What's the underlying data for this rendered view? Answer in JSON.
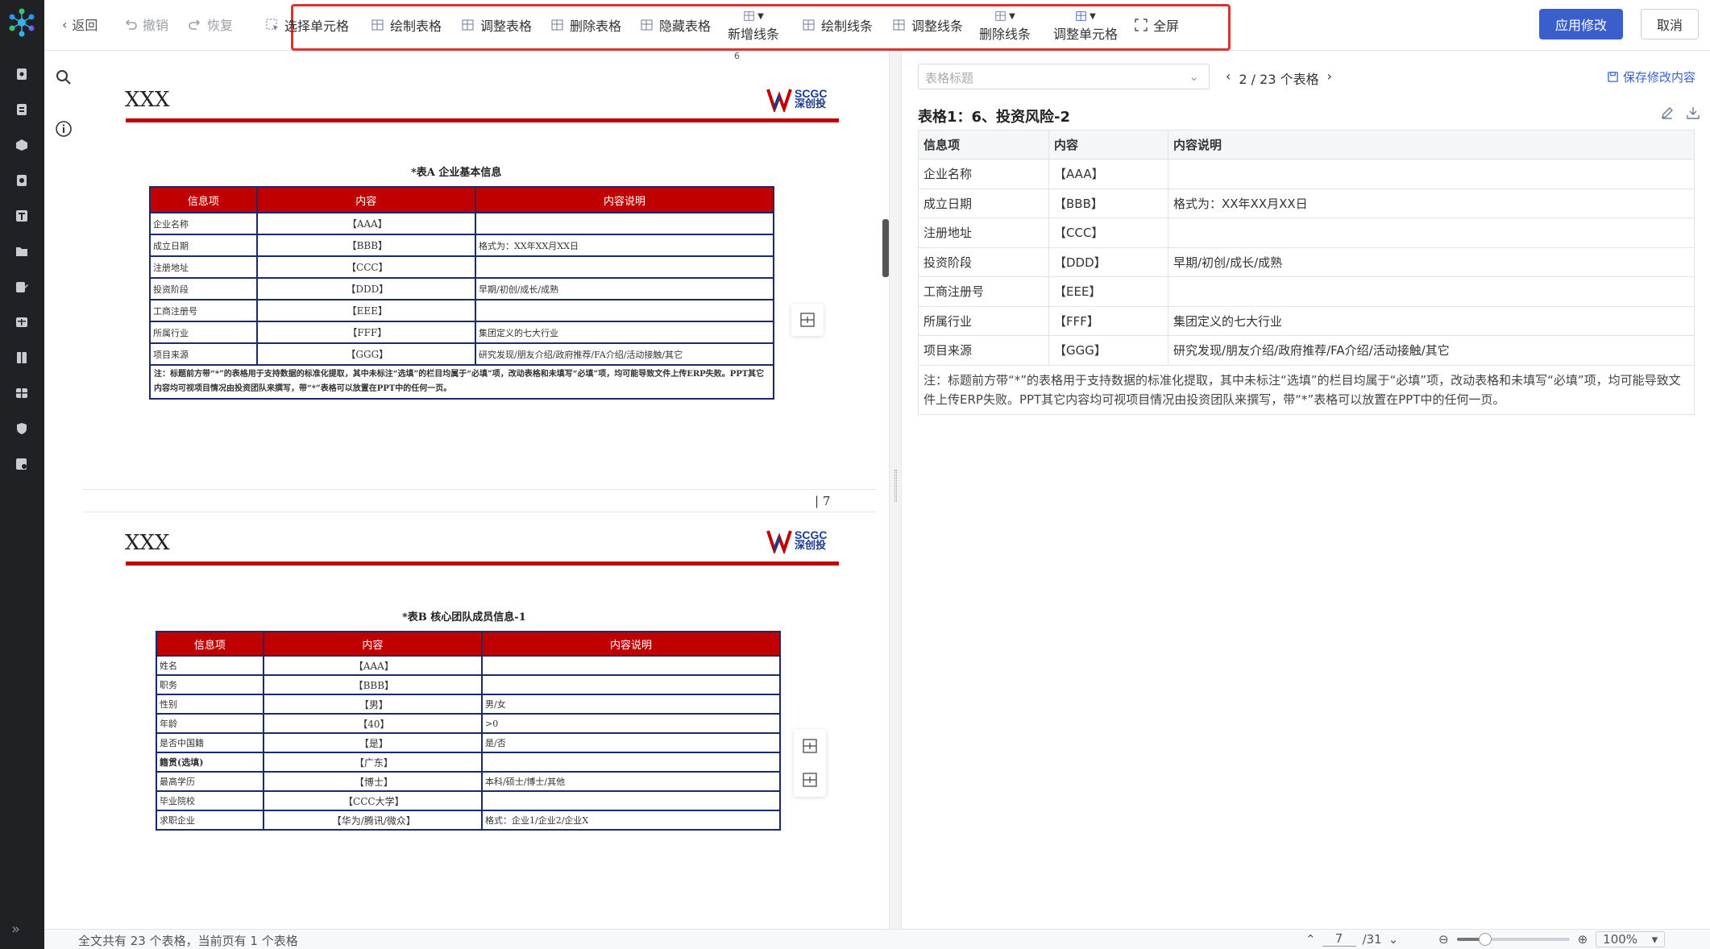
{
  "topbar": {
    "back": "返回",
    "undo": "撤销",
    "redo": "恢复",
    "tools": {
      "select_cell": "选择单元格",
      "draw_table": "绘制表格",
      "adjust_table": "调整表格",
      "delete_table": "删除表格",
      "hide_table": "隐藏表格",
      "add_line": "新增线条",
      "draw_line": "绘制线条",
      "adjust_line": "调整线条",
      "delete_line": "删除线条",
      "adjust_cell": "调整单元格",
      "fullscreen": "全屏"
    },
    "apply": "应用修改",
    "cancel": "取消",
    "accent_color": "#3a5fcd",
    "highlight_color": "#e03131"
  },
  "doc": {
    "page_label_top": "6",
    "slide1": {
      "title": "XXX",
      "brand_en": "SCGC",
      "brand_cn": "深创投",
      "table_caption": "*表A 企业基本信息",
      "headers": [
        "信息项",
        "内容",
        "内容说明"
      ],
      "rows": [
        [
          "企业名称",
          "【AAA】",
          ""
        ],
        [
          "成立日期",
          "【BBB】",
          "格式为：XX年XX月XX日"
        ],
        [
          "注册地址",
          "【CCC】",
          ""
        ],
        [
          "投资阶段",
          "【DDD】",
          "早期/初创/成长/成熟"
        ],
        [
          "工商注册号",
          "【EEE】",
          ""
        ],
        [
          "所属行业",
          "【FFF】",
          "集团定义的七大行业"
        ],
        [
          "项目来源",
          "【GGG】",
          "研究发现/朋友介绍/政府推荐/FA介绍/活动接触/其它"
        ]
      ],
      "note": "注：标题前方带“*”的表格用于支持数据的标准化提取，其中未标注“选填”的栏目均属于“必填”项，改动表格和未填写“必填”项，均可能导致文件上传ERP失败。PPT其它内容均可视项目情况由投资团队来撰写，带“*”表格可以放置在PPT中的任何一页。",
      "page_no": "| 7"
    },
    "slide2": {
      "title": "XXX",
      "brand_en": "SCGC",
      "brand_cn": "深创投",
      "table_caption": "*表B 核心团队成员信息-1",
      "headers": [
        "信息项",
        "内容",
        "内容说明"
      ],
      "rows": [
        [
          "姓名",
          "【AAA】",
          ""
        ],
        [
          "职务",
          "【BBB】",
          ""
        ],
        [
          "性别",
          "【男】",
          "男/女"
        ],
        [
          "年龄",
          "【40】",
          ">0"
        ],
        [
          "是否中国籍",
          "【是】",
          "是/否"
        ],
        [
          "籍贯(选填)",
          "【广东】",
          ""
        ],
        [
          "最高学历",
          "【博士】",
          "本科/硕士/博士/其他"
        ],
        [
          "毕业院校",
          "【CCC大学】",
          ""
        ],
        [
          "求职企业",
          "【华为/腾讯/微众】",
          "格式：企业1/企业2/企业X"
        ]
      ]
    }
  },
  "right": {
    "select_placeholder": "表格标题",
    "pager": "2 / 23 个表格",
    "save": "保存修改内容",
    "title": "表格1：6、投资风险-2",
    "headers": [
      "信息项",
      "内容",
      "内容说明"
    ],
    "rows": [
      [
        "企业名称",
        "【AAA】",
        ""
      ],
      [
        "成立日期",
        "【BBB】",
        "格式为：XX年XX月XX日"
      ],
      [
        "注册地址",
        "【CCC】",
        ""
      ],
      [
        "投资阶段",
        "【DDD】",
        "早期/初创/成长/成熟"
      ],
      [
        "工商注册号",
        "【EEE】",
        ""
      ],
      [
        "所属行业",
        "【FFF】",
        "集团定义的七大行业"
      ],
      [
        "项目来源",
        "【GGG】",
        "研究发现/朋友介绍/政府推荐/FA介绍/活动接触/其它"
      ]
    ],
    "note": "注：标题前方带“*”的表格用于支持数据的标准化提取，其中未标注“选填”的栏目均属于“必填”项，改动表格和未填写“必填”项，均可能导致文件上传ERP失败。PPT其它内容均可视项目情况由投资团队来撰写，带“*”表格可以放置在PPT中的任何一页。"
  },
  "status": {
    "summary": "全文共有 23 个表格，当前页有 1 个表格",
    "current_page": "7",
    "total_pages": "/31",
    "zoom": "100%",
    "zoom_fraction": 0.25
  }
}
